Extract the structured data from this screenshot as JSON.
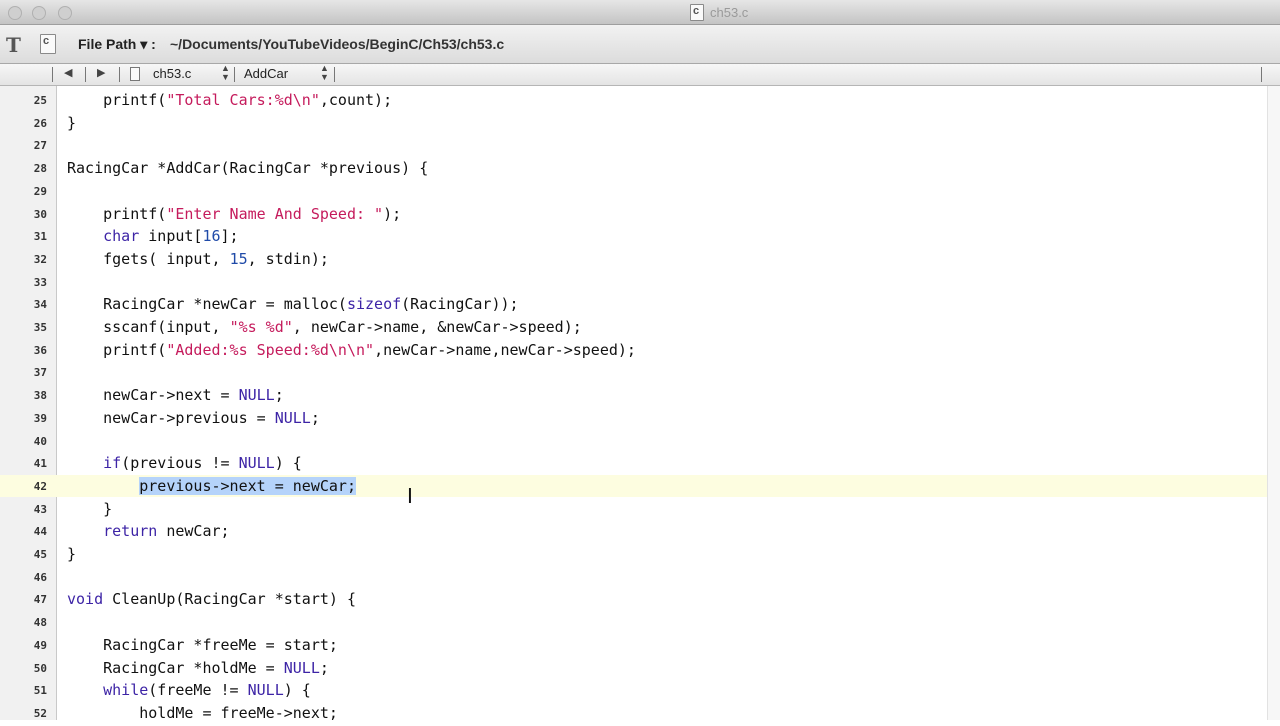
{
  "window": {
    "title": "ch53.c"
  },
  "toolbar": {
    "text_tool_glyph": "T",
    "file_path_label": "File Path ▾ :",
    "file_path_value": "~/Documents/YouTubeVideos/BeginC/Ch53/ch53.c"
  },
  "navbar": {
    "back_glyph": "◀",
    "forward_glyph": "▶",
    "file_name": "ch53.c",
    "function_name": "AddCar"
  },
  "editor": {
    "current_line": "42",
    "lines": [
      {
        "n": "25",
        "segs": [
          [
            "    printf(",
            ""
          ],
          [
            "\"Total Cars:%d\\n\"",
            "str"
          ],
          [
            ",count);",
            ""
          ]
        ]
      },
      {
        "n": "26",
        "segs": [
          [
            "}",
            ""
          ]
        ]
      },
      {
        "n": "27",
        "segs": []
      },
      {
        "n": "28",
        "segs": [
          [
            "RacingCar *AddCar(RacingCar *previous) {",
            ""
          ]
        ]
      },
      {
        "n": "29",
        "segs": []
      },
      {
        "n": "30",
        "segs": [
          [
            "    printf(",
            ""
          ],
          [
            "\"Enter Name And Speed: \"",
            "str"
          ],
          [
            ");",
            ""
          ]
        ]
      },
      {
        "n": "31",
        "segs": [
          [
            "    ",
            ""
          ],
          [
            "char",
            "kw"
          ],
          [
            " input[",
            ""
          ],
          [
            "16",
            "num"
          ],
          [
            "];",
            ""
          ]
        ]
      },
      {
        "n": "32",
        "segs": [
          [
            "    fgets( input, ",
            ""
          ],
          [
            "15",
            "num"
          ],
          [
            ", stdin);",
            ""
          ]
        ]
      },
      {
        "n": "33",
        "segs": []
      },
      {
        "n": "34",
        "segs": [
          [
            "    RacingCar *newCar = malloc(",
            ""
          ],
          [
            "sizeof",
            "kw"
          ],
          [
            "(RacingCar));",
            ""
          ]
        ]
      },
      {
        "n": "35",
        "segs": [
          [
            "    sscanf(input, ",
            ""
          ],
          [
            "\"%s %d\"",
            "str"
          ],
          [
            ", newCar->name, &newCar->speed);",
            ""
          ]
        ]
      },
      {
        "n": "36",
        "segs": [
          [
            "    printf(",
            ""
          ],
          [
            "\"Added:%s Speed:%d\\n\\n\"",
            "str"
          ],
          [
            ",newCar->name,newCar->speed);",
            ""
          ]
        ]
      },
      {
        "n": "37",
        "segs": []
      },
      {
        "n": "38",
        "segs": [
          [
            "    newCar->next = ",
            ""
          ],
          [
            "NULL",
            "kw"
          ],
          [
            ";",
            ""
          ]
        ]
      },
      {
        "n": "39",
        "segs": [
          [
            "    newCar->previous = ",
            ""
          ],
          [
            "NULL",
            "kw"
          ],
          [
            ";",
            ""
          ]
        ]
      },
      {
        "n": "40",
        "segs": []
      },
      {
        "n": "41",
        "segs": [
          [
            "    ",
            ""
          ],
          [
            "if",
            "kw"
          ],
          [
            "(previous != ",
            ""
          ],
          [
            "NULL",
            "kw"
          ],
          [
            ") {",
            ""
          ]
        ]
      },
      {
        "n": "42",
        "segs": [
          [
            "        ",
            ""
          ],
          [
            "previous->next = newCar;",
            "sel"
          ]
        ]
      },
      {
        "n": "43",
        "segs": [
          [
            "    }",
            ""
          ]
        ]
      },
      {
        "n": "44",
        "segs": [
          [
            "    ",
            ""
          ],
          [
            "return",
            "kw"
          ],
          [
            " newCar;",
            ""
          ]
        ]
      },
      {
        "n": "45",
        "segs": [
          [
            "}",
            ""
          ]
        ]
      },
      {
        "n": "46",
        "segs": []
      },
      {
        "n": "47",
        "segs": [
          [
            "void",
            "kw"
          ],
          [
            " CleanUp(RacingCar *start) {",
            ""
          ]
        ]
      },
      {
        "n": "48",
        "segs": []
      },
      {
        "n": "49",
        "segs": [
          [
            "    RacingCar *freeMe = start;",
            ""
          ]
        ]
      },
      {
        "n": "50",
        "segs": [
          [
            "    RacingCar *holdMe = ",
            ""
          ],
          [
            "NULL",
            "kw"
          ],
          [
            ";",
            ""
          ]
        ]
      },
      {
        "n": "51",
        "segs": [
          [
            "    ",
            ""
          ],
          [
            "while",
            "kw"
          ],
          [
            "(freeMe != ",
            ""
          ],
          [
            "NULL",
            "kw"
          ],
          [
            ") {",
            ""
          ]
        ]
      },
      {
        "n": "52",
        "segs": [
          [
            "        holdMe = freeMe->next;",
            ""
          ]
        ]
      }
    ]
  }
}
